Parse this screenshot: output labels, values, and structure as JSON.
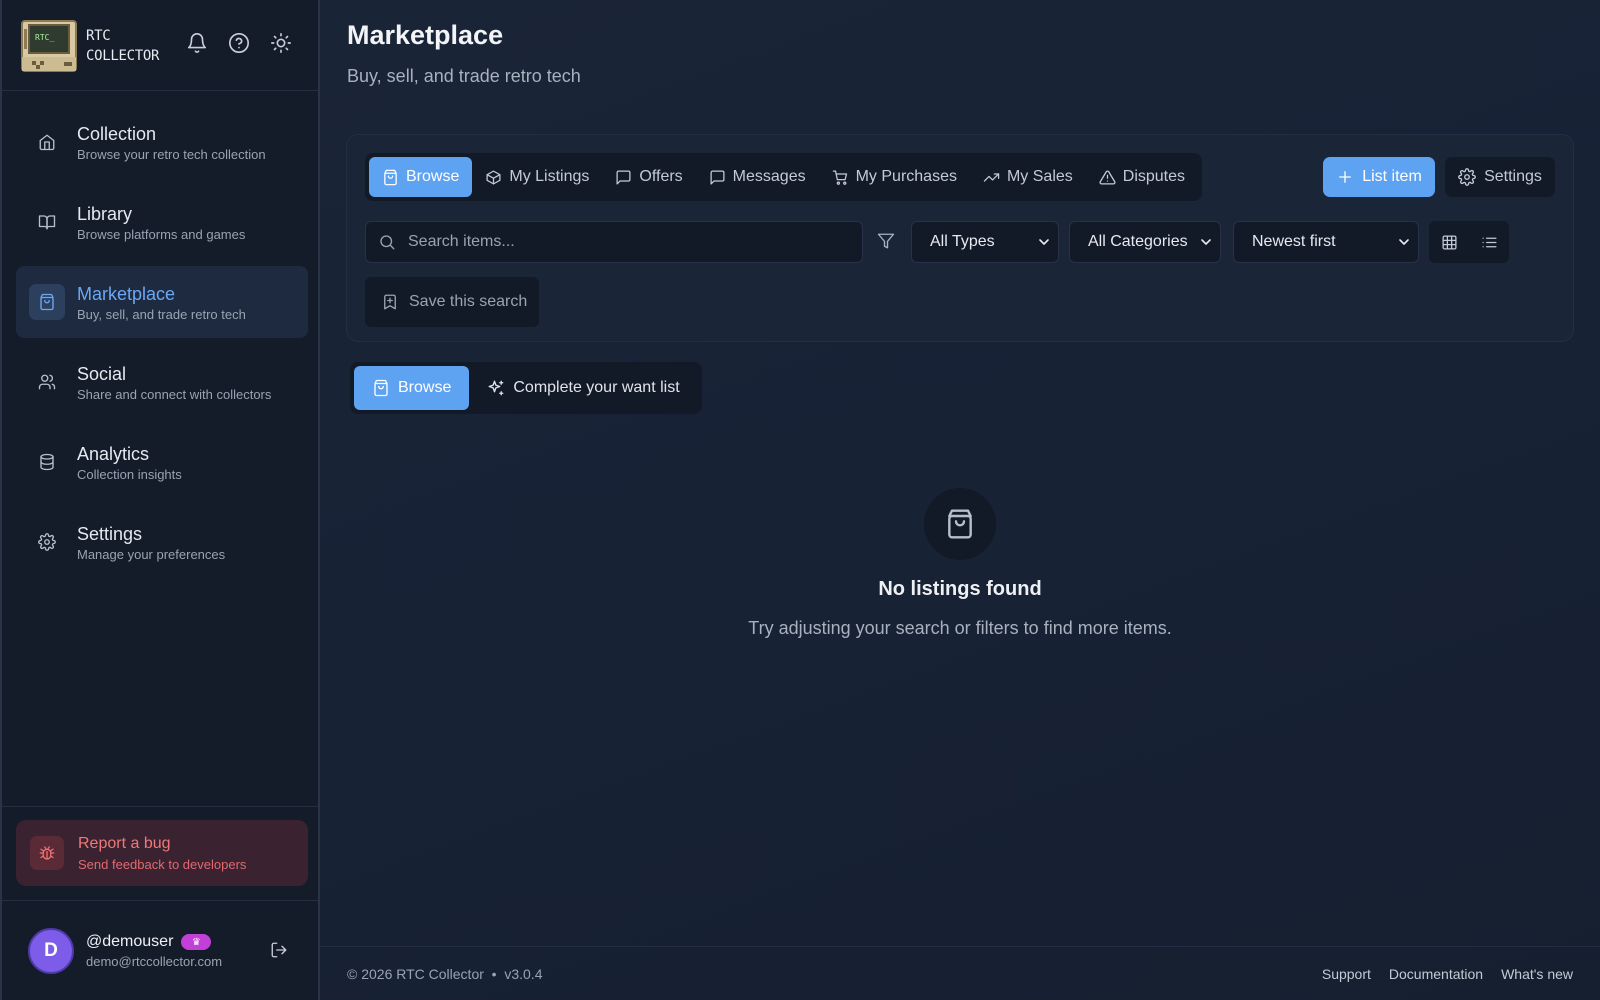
{
  "brand": {
    "line1": "RTC",
    "line2": "COLLECTOR",
    "screen_text": "RTC_"
  },
  "sidebar": {
    "items": [
      {
        "title": "Collection",
        "subtitle": "Browse your retro tech collection",
        "icon": "home-icon"
      },
      {
        "title": "Library",
        "subtitle": "Browse platforms and games",
        "icon": "book-icon"
      },
      {
        "title": "Marketplace",
        "subtitle": "Buy, sell, and trade retro tech",
        "icon": "shopping-bag-icon",
        "active": true
      },
      {
        "title": "Social",
        "subtitle": "Share and connect with collectors",
        "icon": "users-icon"
      },
      {
        "title": "Analytics",
        "subtitle": "Collection insights",
        "icon": "database-icon"
      },
      {
        "title": "Settings",
        "subtitle": "Manage your preferences",
        "icon": "gear-icon"
      }
    ],
    "bug": {
      "title": "Report a bug",
      "subtitle": "Send feedback to developers"
    },
    "user": {
      "initial": "D",
      "name": "@demouser",
      "email": "demo@rtccollector.com"
    }
  },
  "page": {
    "title": "Marketplace",
    "subtitle": "Buy, sell, and trade retro tech"
  },
  "tabs": [
    {
      "label": "Browse",
      "active": true
    },
    {
      "label": "My Listings"
    },
    {
      "label": "Offers"
    },
    {
      "label": "Messages"
    },
    {
      "label": "My Purchases"
    },
    {
      "label": "My Sales"
    },
    {
      "label": "Disputes"
    }
  ],
  "actions": {
    "list_item": "List item",
    "settings": "Settings"
  },
  "search": {
    "placeholder": "Search items..."
  },
  "filters": {
    "type": "All Types",
    "category": "All Categories",
    "sort": "Newest first"
  },
  "save_search": "Save this search",
  "segments": {
    "browse": "Browse",
    "want_list": "Complete your want list"
  },
  "empty": {
    "title": "No listings found",
    "subtitle": "Try adjusting your search or filters to find more items."
  },
  "footer": {
    "copyright": "© 2026 RTC Collector  •  v3.0.4",
    "links": {
      "support": "Support",
      "docs": "Documentation",
      "whats_new": "What's new"
    }
  },
  "colors": {
    "accent": "#5ea2f2",
    "danger": "#f07878",
    "premium": "#c23fd8",
    "avatar": "#7c5ce8"
  }
}
